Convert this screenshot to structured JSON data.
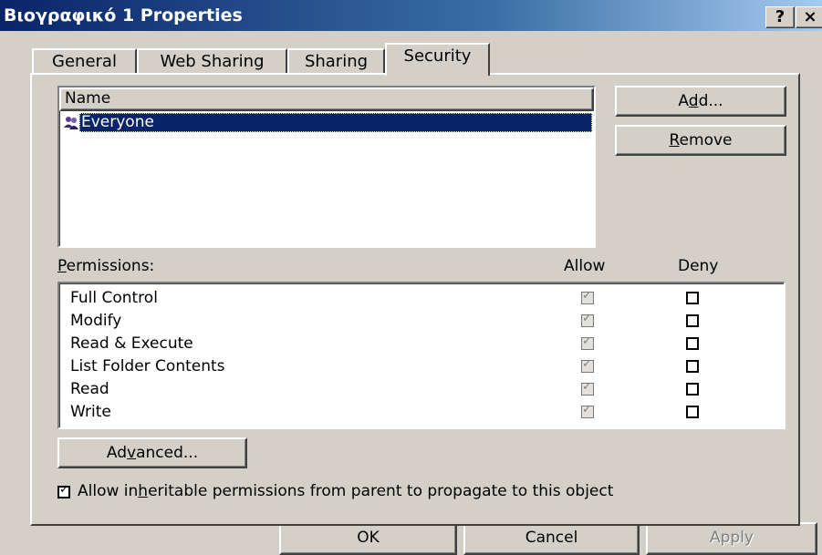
{
  "window": {
    "title": "Βιογραφικό 1 Properties",
    "help_button": "?",
    "close_button": "×"
  },
  "tabs": [
    {
      "label": "General"
    },
    {
      "label": "Web Sharing"
    },
    {
      "label": "Sharing"
    },
    {
      "label": "Security",
      "active": true
    }
  ],
  "names_list": {
    "header": "Name",
    "items": [
      {
        "name": "Everyone",
        "selected": true
      }
    ]
  },
  "buttons": {
    "add_pre": "A",
    "add_u": "d",
    "add_post": "d...",
    "remove_u": "R",
    "remove_post": "emove",
    "advanced_pre": "Ad",
    "advanced_u": "v",
    "advanced_post": "anced...",
    "ok": "OK",
    "cancel": "Cancel",
    "apply": "Apply"
  },
  "permissions": {
    "label_u": "P",
    "label_post": "ermissions:",
    "allow_header": "Allow",
    "deny_header": "Deny",
    "rows": [
      {
        "name": "Full Control",
        "allow": true,
        "deny": false
      },
      {
        "name": "Modify",
        "allow": true,
        "deny": false
      },
      {
        "name": "Read & Execute",
        "allow": true,
        "deny": false
      },
      {
        "name": "List Folder Contents",
        "allow": true,
        "deny": false
      },
      {
        "name": "Read",
        "allow": true,
        "deny": false
      },
      {
        "name": "Write",
        "allow": true,
        "deny": false
      }
    ]
  },
  "inherit": {
    "checked": true,
    "text_pre": "Allow in",
    "text_u": "h",
    "text_post": "eritable permissions from parent to propagate to this object"
  }
}
